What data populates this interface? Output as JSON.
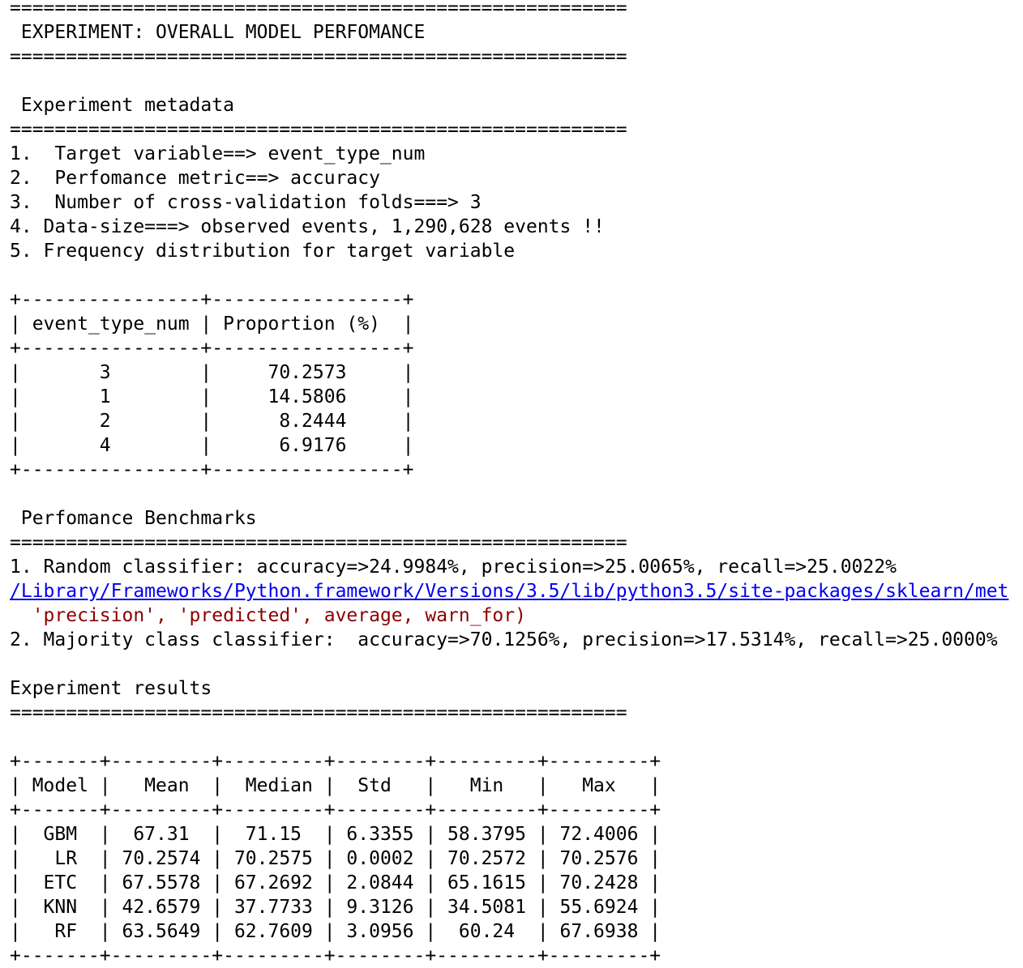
{
  "lines": [
    {
      "kind": "text",
      "text": "======================================================="
    },
    {
      "kind": "text",
      "text": " EXPERIMENT: OVERALL MODEL PERFOMANCE"
    },
    {
      "kind": "text",
      "text": "======================================================="
    },
    {
      "kind": "blank",
      "text": ""
    },
    {
      "kind": "text",
      "text": " Experiment metadata"
    },
    {
      "kind": "text",
      "text": "======================================================="
    },
    {
      "kind": "text",
      "text": "1.  Target variable==> event_type_num"
    },
    {
      "kind": "text",
      "text": "2.  Perfomance metric==> accuracy"
    },
    {
      "kind": "text",
      "text": "3.  Number of cross-validation folds===> 3"
    },
    {
      "kind": "text",
      "text": "4. Data-size===> observed events, 1,290,628 events !!"
    },
    {
      "kind": "text",
      "text": "5. Frequency distribution for target variable"
    },
    {
      "kind": "blank",
      "text": ""
    },
    {
      "kind": "text",
      "text": "+----------------+-----------------+"
    },
    {
      "kind": "text",
      "text": "| event_type_num | Proportion (%)  |"
    },
    {
      "kind": "text",
      "text": "+----------------+-----------------+"
    },
    {
      "kind": "text",
      "text": "|       3        |     70.2573     |"
    },
    {
      "kind": "text",
      "text": "|       1        |     14.5806     |"
    },
    {
      "kind": "text",
      "text": "|       2        |      8.2444     |"
    },
    {
      "kind": "text",
      "text": "|       4        |      6.9176     |"
    },
    {
      "kind": "text",
      "text": "+----------------+-----------------+"
    },
    {
      "kind": "blank",
      "text": ""
    },
    {
      "kind": "text",
      "text": " Perfomance Benchmarks"
    },
    {
      "kind": "text",
      "text": "======================================================="
    },
    {
      "kind": "text",
      "text": "1. Random classifier: accuracy=>24.9984%, precision=>25.0065%, recall=>25.0022%"
    },
    {
      "kind": "link",
      "text": "/Library/Frameworks/Python.framework/Versions/3.5/lib/python3.5/site-packages/sklearn/met"
    },
    {
      "kind": "warn",
      "text": "  'precision', 'predicted', average, warn_for)"
    },
    {
      "kind": "text",
      "text": "2. Majority class classifier:  accuracy=>70.1256%, precision=>17.5314%, recall=>25.0000%"
    },
    {
      "kind": "blank",
      "text": ""
    },
    {
      "kind": "text",
      "text": "Experiment results"
    },
    {
      "kind": "text",
      "text": "======================================================="
    },
    {
      "kind": "blank",
      "text": ""
    },
    {
      "kind": "text",
      "text": "+-------+---------+---------+--------+---------+---------+"
    },
    {
      "kind": "text",
      "text": "| Model |   Mean  |  Median |  Std   |   Min   |   Max   |"
    },
    {
      "kind": "text",
      "text": "+-------+---------+---------+--------+---------+---------+"
    },
    {
      "kind": "text",
      "text": "|  GBM  |  67.31  |  71.15  | 6.3355 | 58.3795 | 72.4006 |"
    },
    {
      "kind": "text",
      "text": "|   LR  | 70.2574 | 70.2575 | 0.0002 | 70.2572 | 70.2576 |"
    },
    {
      "kind": "text",
      "text": "|  ETC  | 67.5578 | 67.2692 | 2.0844 | 65.1615 | 70.2428 |"
    },
    {
      "kind": "text",
      "text": "|  KNN  | 42.6579 | 37.7733 | 9.3126 | 34.5081 | 55.6924 |"
    },
    {
      "kind": "text",
      "text": "|   RF  | 63.5649 | 62.7609 | 3.0956 |  60.24  | 67.6938 |"
    },
    {
      "kind": "text",
      "text": "+-------+---------+---------+--------+---------+---------+"
    }
  ]
}
